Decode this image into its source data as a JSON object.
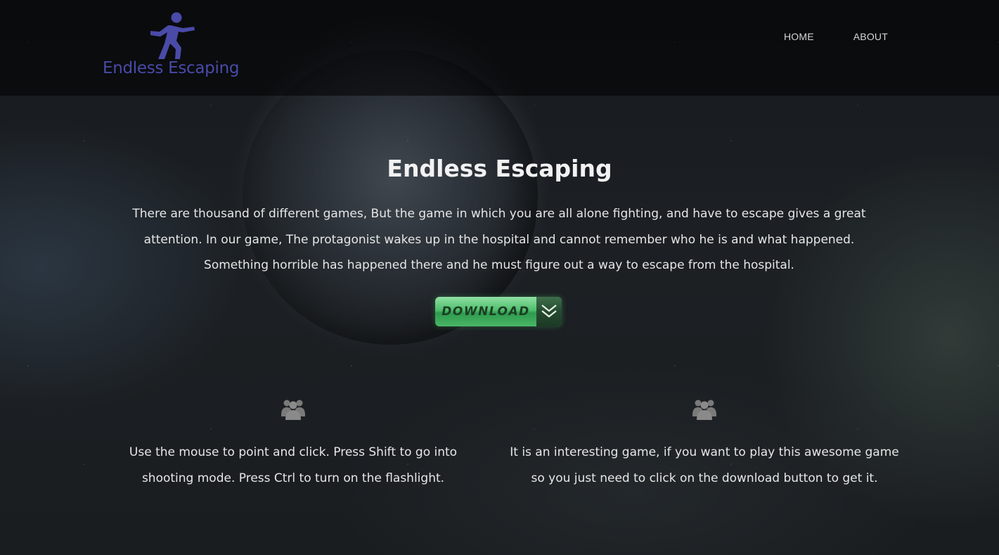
{
  "header": {
    "logo_text": "Endless Escaping",
    "nav": [
      {
        "label": "HOME"
      },
      {
        "label": "ABOUT"
      }
    ]
  },
  "hero": {
    "title": "Endless Escaping",
    "description": "There are thousand of different games, But the game in which you are all alone fighting, and have to escape gives a great attention. In our game, The protagonist wakes up in the hospital and cannot remember who he is and what happened. Something horrible has happened there and he must figure out a way to escape from the hospital.",
    "download_label": "DOWNLOAD"
  },
  "features": [
    {
      "icon": "users-icon",
      "text": "Use the mouse to point and click. Press Shift to go into shooting mode. Press Ctrl to turn on the flashlight."
    },
    {
      "icon": "users-icon",
      "text": "It is an interesting game, if you want to play this awesome game so you just need to click on the download button to get it."
    }
  ],
  "colors": {
    "logo": "#4a4aa8",
    "download_green": "#4fbe6c",
    "icon_grey": "#7a7a7a"
  }
}
